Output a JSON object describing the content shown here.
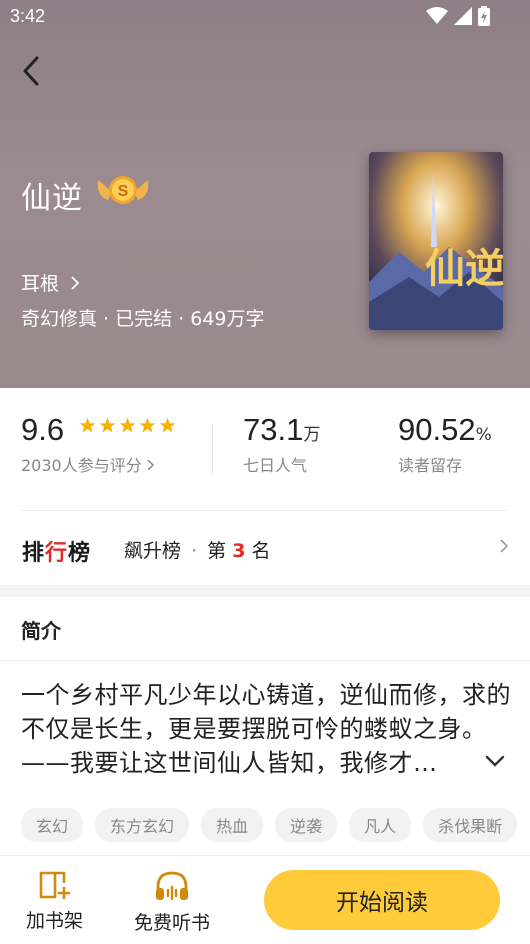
{
  "status": {
    "time": "3:42"
  },
  "book": {
    "title": "仙逆",
    "author": "耳根",
    "meta": "奇幻修真 · 已完结 · 649万字",
    "cover_text": "仙逆"
  },
  "stats": {
    "rating": {
      "value": "9.6",
      "stars": 5,
      "sub": "2030人参与评分"
    },
    "popularity": {
      "value": "73.1",
      "unit": "万",
      "sub": "七日人气"
    },
    "retention": {
      "value": "90.52",
      "unit": "%",
      "sub": "读者留存"
    }
  },
  "rank": {
    "logo_pre": "排",
    "logo_red": "行",
    "logo_post": "榜",
    "list": "飙升榜",
    "sep": "·",
    "pos_pre": "第",
    "position": "3",
    "pos_post": "名"
  },
  "intro": {
    "heading": "简介",
    "text": "一个乡村平凡少年以心铸道，逆仙而修，求的不仅是长生，更是要摆脱可怜的蝼蚁之身。——我要让这世间仙人皆知，我修才…"
  },
  "tags": [
    "玄幻",
    "东方玄幻",
    "热血",
    "逆袭",
    "凡人",
    "杀伐果断"
  ],
  "bottom": {
    "bookshelf": "加书架",
    "listen": "免费听书",
    "read": "开始阅读"
  },
  "colors": {
    "accent": "#ffcb3a",
    "rank_red": "#e02a2a",
    "star": "#f5b400"
  }
}
